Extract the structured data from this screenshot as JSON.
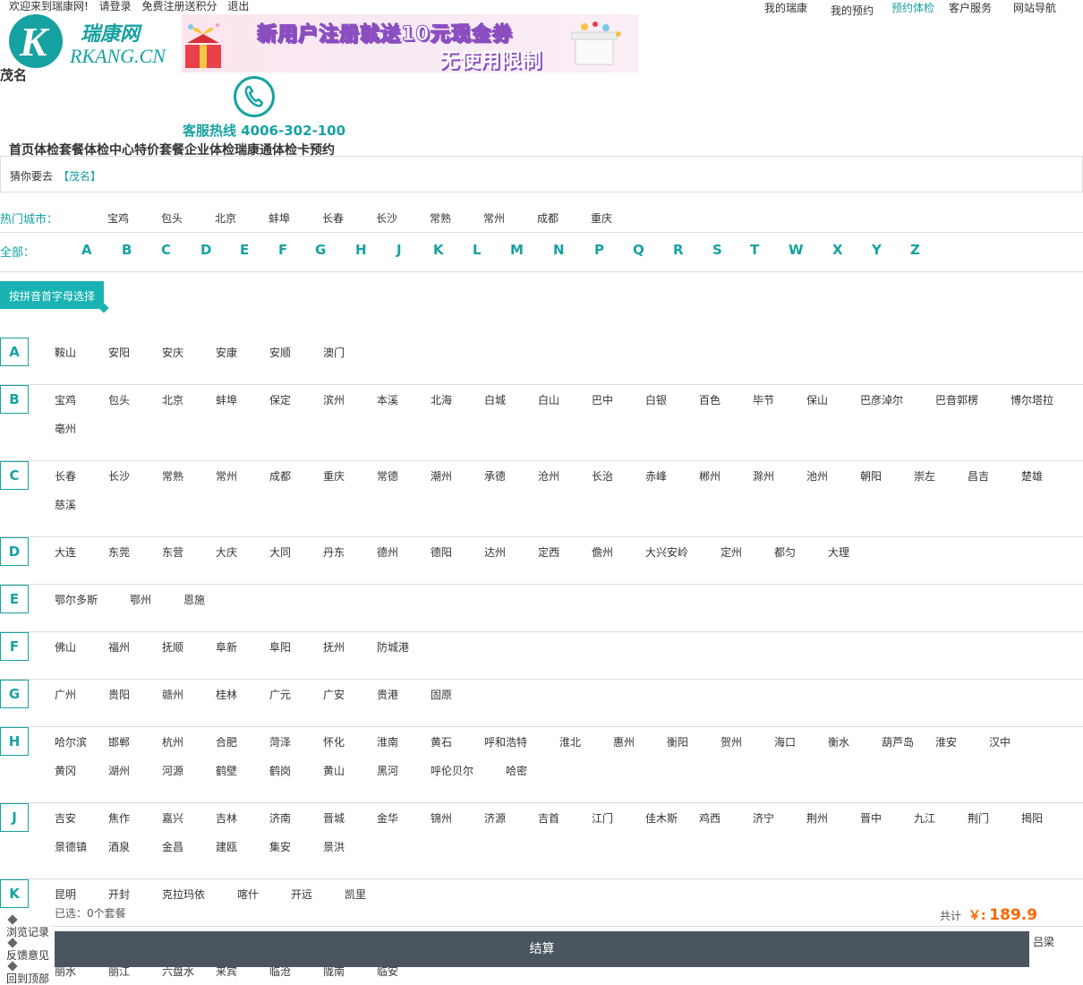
{
  "topbar": {
    "welcome": "欢迎来到瑞康网!",
    "login": "请登录",
    "register": "免费注册送积分",
    "logout": "退出",
    "nav": [
      "我的瑞康",
      "我的预约",
      "预约体检",
      "客户服务",
      "网站导航"
    ]
  },
  "logo": {
    "cn": "瑞康网",
    "en": "RKANG.CN",
    "mark": "K"
  },
  "banner": {
    "line1": "新用户注册就送10元现金券",
    "line2": "无使用限制"
  },
  "current_city": "茂名",
  "hotline": "客服热线 4006-302-100",
  "main_nav": "首页体检套餐体检中心特价套餐企业体检瑞康通体检卡预约",
  "guess": {
    "label": "猜你要去",
    "city": "【茂名】"
  },
  "hot_cities": {
    "label": "热门城市：",
    "items": [
      "宝鸡",
      "包头",
      "北京",
      "蚌埠",
      "长春",
      "长沙",
      "常熟",
      "常州",
      "成都",
      "重庆"
    ]
  },
  "letters": {
    "label": "全部：",
    "items": [
      "A",
      "B",
      "C",
      "D",
      "E",
      "F",
      "G",
      "H",
      "J",
      "K",
      "L",
      "M",
      "N",
      "P",
      "Q",
      "R",
      "S",
      "T",
      "W",
      "X",
      "Y",
      "Z"
    ]
  },
  "pinyin_tab": "按拼音首字母选择",
  "sections": [
    {
      "letter": "A",
      "cities": [
        "鞍山",
        "安阳",
        "安庆",
        "安康",
        "安顺",
        "澳门"
      ]
    },
    {
      "letter": "B",
      "cities": [
        "宝鸡",
        "包头",
        "北京",
        "蚌埠",
        "保定",
        "滨州",
        "本溪",
        "北海",
        "白城",
        "白山",
        "巴中",
        "白银",
        "百色",
        "毕节",
        "保山",
        "巴彦淖尔",
        "巴音郭楞",
        "博尔塔拉",
        "亳州"
      ]
    },
    {
      "letter": "C",
      "cities": [
        "长春",
        "长沙",
        "常熟",
        "常州",
        "成都",
        "重庆",
        "常德",
        "潮州",
        "承德",
        "沧州",
        "长治",
        "赤峰",
        "郴州",
        "滁州",
        "池州",
        "朝阳",
        "崇左",
        "昌吉",
        "楚雄",
        "慈溪"
      ]
    },
    {
      "letter": "D",
      "cities": [
        "大连",
        "东莞",
        "东营",
        "大庆",
        "大同",
        "丹东",
        "德州",
        "德阳",
        "达州",
        "定西",
        "儋州",
        "大兴安岭",
        "定州",
        "都匀",
        "大理"
      ]
    },
    {
      "letter": "E",
      "cities": [
        "鄂尔多斯",
        "鄂州",
        "恩施"
      ]
    },
    {
      "letter": "F",
      "cities": [
        "佛山",
        "福州",
        "抚顺",
        "阜新",
        "阜阳",
        "抚州",
        "防城港"
      ]
    },
    {
      "letter": "G",
      "cities": [
        "广州",
        "贵阳",
        "赣州",
        "桂林",
        "广元",
        "广安",
        "贵港",
        "固原"
      ]
    },
    {
      "letter": "H",
      "cities": [
        "哈尔滨",
        "邯郸",
        "杭州",
        "合肥",
        "菏泽",
        "怀化",
        "淮南",
        "黄石",
        "呼和浩特",
        "淮北",
        "惠州",
        "衡阳",
        "贺州",
        "海口",
        "衡水",
        "葫芦岛",
        "淮安",
        "汉中",
        "黄冈",
        "湖州",
        "河源",
        "鹤壁",
        "鹤岗",
        "黄山",
        "黑河",
        "呼伦贝尔",
        "哈密"
      ]
    },
    {
      "letter": "J",
      "cities": [
        "吉安",
        "焦作",
        "嘉兴",
        "吉林",
        "济南",
        "晋城",
        "金华",
        "锦州",
        "济源",
        "吉首",
        "江门",
        "佳木斯",
        "鸡西",
        "济宁",
        "荆州",
        "晋中",
        "九江",
        "荆门",
        "揭阳",
        "景德镇",
        "酒泉",
        "金昌",
        "建瓯",
        "集安",
        "景洪"
      ]
    },
    {
      "letter": "K",
      "cities": [
        "昆明",
        "开封",
        "克拉玛依",
        "喀什",
        "开远",
        "凯里"
      ]
    }
  ],
  "tail_cities": [
    "丽水",
    "丽江",
    "六盘水",
    "来宾",
    "临沧",
    "陇南",
    "临安"
  ],
  "extra_city": "吕梁",
  "cart": {
    "selected": "已选：0个套餐",
    "total_label": "共计",
    "currency": "￥:",
    "amount": "189.9",
    "checkout": "结算"
  },
  "side_panel": [
    "浏览记录",
    "反馈意见",
    "回到顶部"
  ],
  "colors": {
    "accent": "#17a2a2",
    "price": "#ff6600",
    "checkout_bg": "#4a5560"
  }
}
